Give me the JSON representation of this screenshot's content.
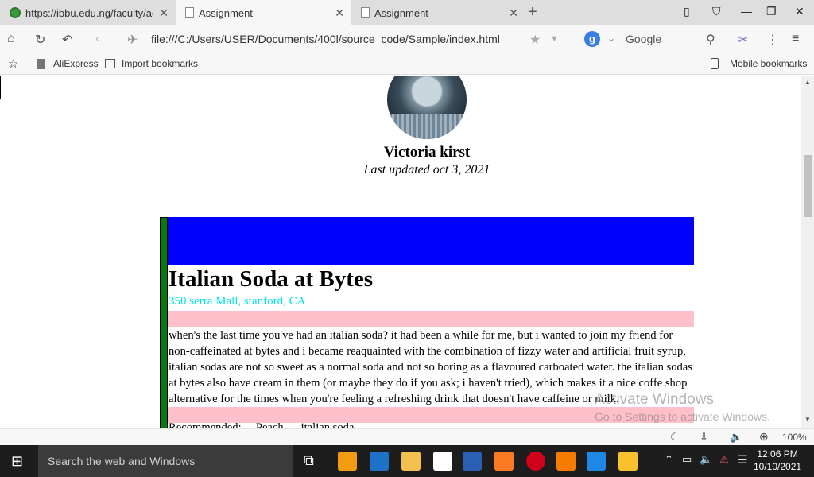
{
  "browser": {
    "tabs": [
      {
        "label": "https://ibbu.edu.ng/faculty/ac"
      },
      {
        "label": "Assignment"
      },
      {
        "label": "Assignment"
      }
    ],
    "url": "file:///C:/Users/USER/Documents/400l/source_code/Sample/index.html",
    "search_engine": "Google",
    "bookmarks": [
      {
        "label": "AliExpress"
      },
      {
        "label": "Import bookmarks"
      }
    ],
    "mobile_bookmarks": "Mobile bookmarks",
    "zoom": "100%"
  },
  "page": {
    "author": "Victoria kirst",
    "updated": "Last updated oct 3, 2021",
    "title": "Italian Soda at Bytes",
    "address": "350 serra Mall, stanford, CA",
    "body": "when's the last time you've had an italian soda? it had been a while for me, but i wanted to join my friend for non-caffeinated at bytes and i became reaquainted with the combination of fizzy water and artificial fruit syrup, italian sodas are not so sweet as a normal soda and not so boring as a flavoured carboated water. the italian sodas at bytes also have cream in them (or maybe they do if you ask; i haven't tried), which makes it a nice coffe shop alternative for the times when you're feeling a refreshing drink that doesn't have caffeine or milk.",
    "trailing": "Recommended: ... Peach, ... italian soda",
    "colors": {
      "blue_block": "#0000ff",
      "green_bar": "#0a7a0a",
      "pink_band": "#ffc0cb",
      "address": "#00e5e5"
    }
  },
  "watermark": {
    "line1": "Activate Windows",
    "line2": "Go to Settings to activate Windows."
  },
  "taskbar": {
    "search_placeholder": "Search the web and Windows",
    "time": "12:06 PM",
    "date": "10/10/2021"
  }
}
